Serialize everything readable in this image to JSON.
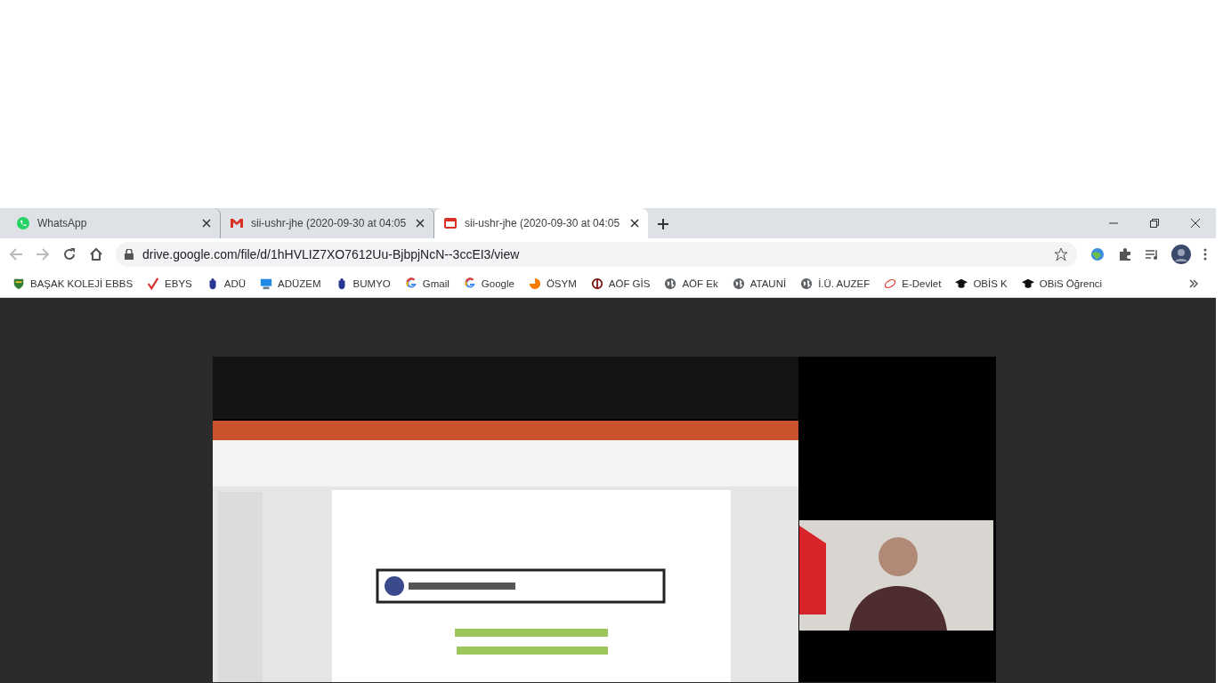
{
  "tabs": [
    {
      "title": "WhatsApp",
      "kind": "whatsapp",
      "selected": false
    },
    {
      "title": "sii-ushr-jhe (2020-09-30 at 04:05",
      "kind": "gmail",
      "selected": false
    },
    {
      "title": "sii-ushr-jhe (2020-09-30 at 04:05",
      "kind": "video",
      "selected": true
    }
  ],
  "address": "drive.google.com/file/d/1hHVLIZ7XO7612Uu-BjbpjNcN--3ccEI3/view",
  "bookmarks": [
    {
      "label": "BAŞAK KOLEJİ EBBS",
      "kind": "shield"
    },
    {
      "label": "EBYS",
      "kind": "check"
    },
    {
      "label": "ADÜ",
      "kind": "crest"
    },
    {
      "label": "ADÜZEM",
      "kind": "monitor"
    },
    {
      "label": "BUMYO",
      "kind": "crest"
    },
    {
      "label": "Gmail",
      "kind": "google"
    },
    {
      "label": "Google",
      "kind": "google"
    },
    {
      "label": "ÖSYM",
      "kind": "pie"
    },
    {
      "label": "AÖF GİS",
      "kind": "ring"
    },
    {
      "label": "AÖF Ek",
      "kind": "globe"
    },
    {
      "label": "ATAUNİ",
      "kind": "globe"
    },
    {
      "label": "İ.Ü. AUZEF",
      "kind": "globe"
    },
    {
      "label": "E-Devlet",
      "kind": "swirl"
    },
    {
      "label": "OBİS K",
      "kind": "cap"
    },
    {
      "label": "OBiS Öğrenci",
      "kind": "cap"
    }
  ]
}
